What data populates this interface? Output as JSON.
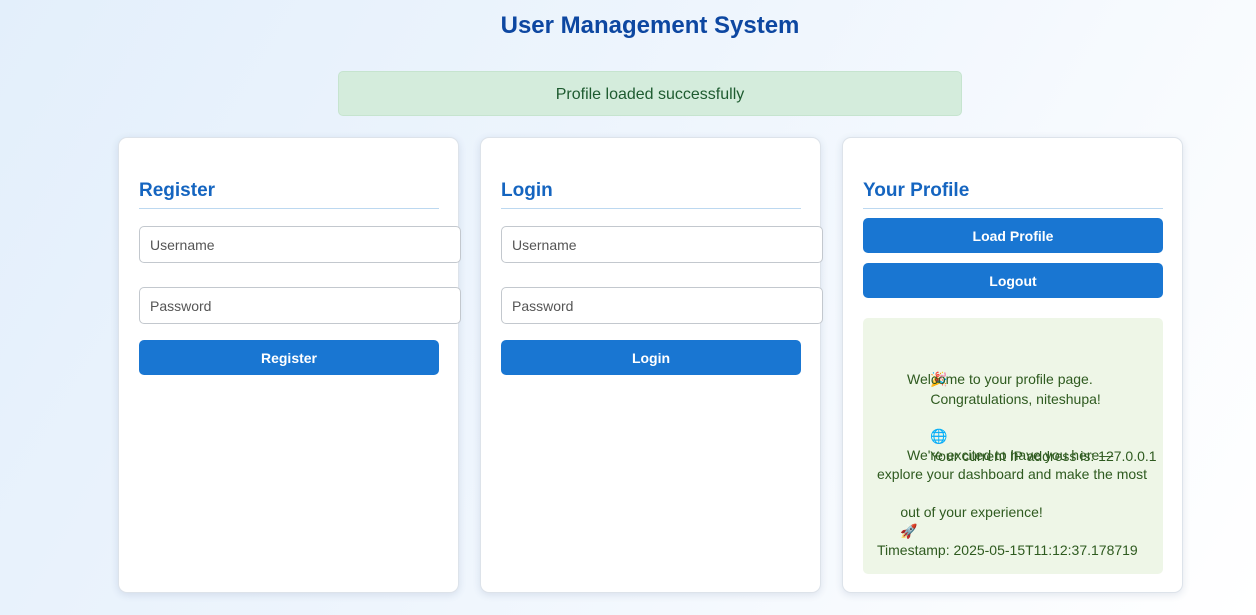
{
  "page": {
    "title": "User Management System",
    "banner": "Profile loaded successfully"
  },
  "register": {
    "heading": "Register",
    "username_placeholder": "Username",
    "password_placeholder": "Password",
    "button_label": "Register"
  },
  "login": {
    "heading": "Login",
    "username_placeholder": "Username",
    "password_placeholder": "Password",
    "button_label": "Login"
  },
  "profile": {
    "heading": "Your Profile",
    "load_button": "Load Profile",
    "logout_button": "Logout",
    "greeting_icon": "🎉",
    "greeting_line1": "Congratulations, niteshupa!",
    "greeting_line2": "Welcome to your profile page.",
    "ip_icon": "🌐",
    "ip_text": "Your current IP address is: 127.0.0.1",
    "excited_line1": "We're excited to have you here—",
    "excited_line2": "explore your dashboard and make the most",
    "excited_line3": "out of your experience!",
    "rocket_icon": "🚀",
    "timestamp": "Timestamp: 2025-05-15T11:12:37.178719"
  },
  "colors": {
    "accent": "#1976d2",
    "heading": "#1565c0",
    "title": "#0d47a1",
    "success_bg": "#d4ecdc",
    "profile_bg": "#eef6e7"
  }
}
